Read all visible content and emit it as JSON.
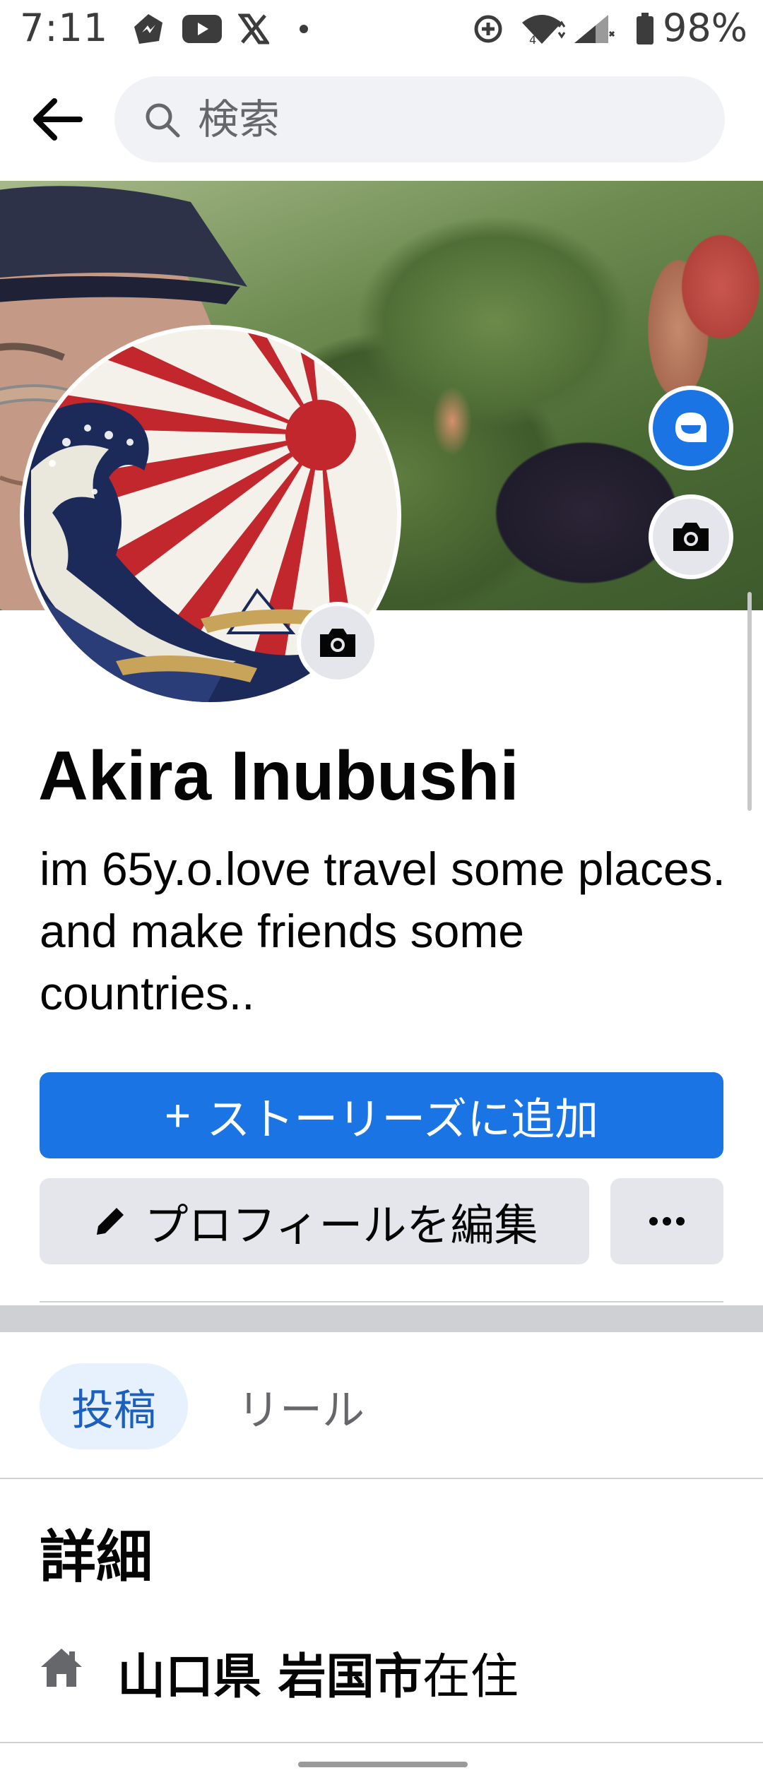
{
  "status_bar": {
    "time": "7:11",
    "battery": "98%",
    "icons": [
      "messenger-like-icon",
      "youtube-icon",
      "x-icon",
      "dot-icon",
      "data-saver-icon",
      "wifi-icon",
      "signal-icon",
      "battery-icon"
    ]
  },
  "header": {
    "search_placeholder": "検索"
  },
  "profile": {
    "name": "Akira Inubushi",
    "bio": "im 65y.o.love travel some places. and make friends some countries.."
  },
  "actions": {
    "add_story_plus": "+",
    "add_story_label": "ストーリーズに追加",
    "edit_profile_label": "プロフィールを編集",
    "more_label": "···"
  },
  "tabs": {
    "posts": "投稿",
    "reels": "リール"
  },
  "details": {
    "title": "詳細",
    "location_prefix": "山口県 岩国市",
    "location_suffix": "在住"
  },
  "colors": {
    "primary": "#1b74e4",
    "tab_active_bg": "#e7f0fd",
    "secondary_bg": "#e4e6eb",
    "divider": "#ced0d4"
  }
}
